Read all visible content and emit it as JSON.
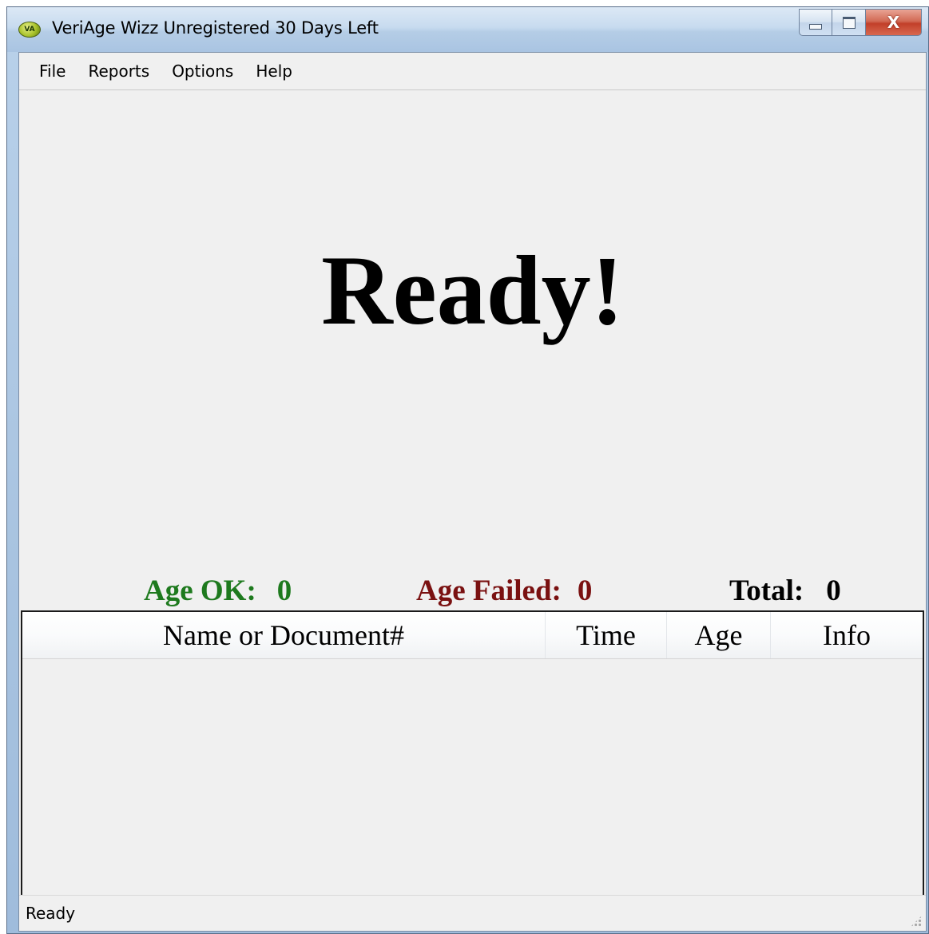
{
  "window": {
    "title": "VeriAge Wizz Unregistered 30 Days Left",
    "app_icon_text": "VA",
    "close_glyph": "X"
  },
  "menu": {
    "items": [
      "File",
      "Reports",
      "Options",
      "Help"
    ]
  },
  "main": {
    "status_message": "Ready!"
  },
  "stats": {
    "ok_label": "Age OK:",
    "ok_value": "0",
    "failed_label": "Age Failed:",
    "failed_value": "0",
    "total_label": "Total:",
    "total_value": "0",
    "ok_color": "#1e7a1e",
    "failed_color": "#7a1111"
  },
  "table": {
    "columns": [
      "Name or Document#",
      "Time",
      "Age",
      "Info"
    ],
    "rows": []
  },
  "statusbar": {
    "text": "Ready"
  }
}
